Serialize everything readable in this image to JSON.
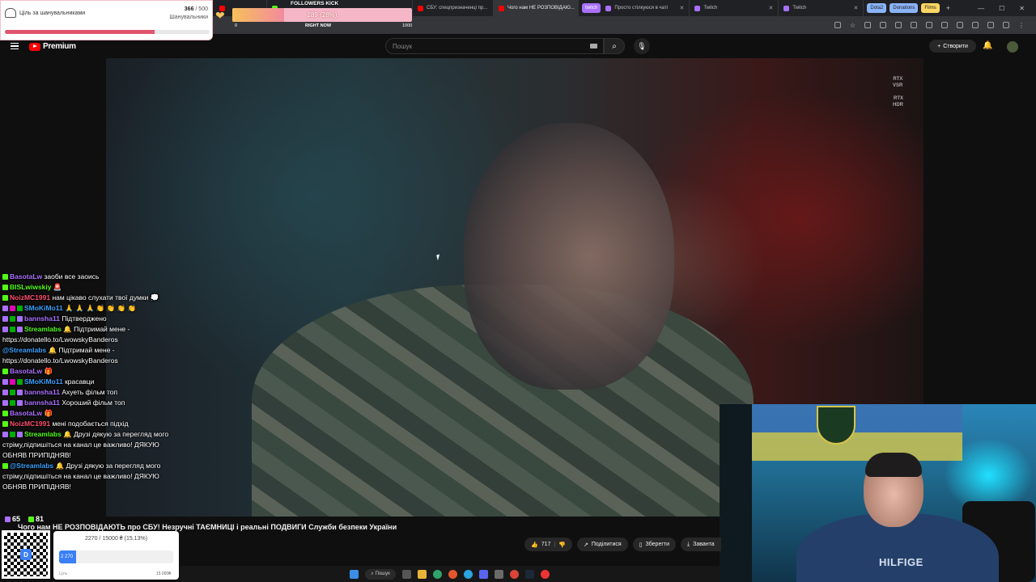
{
  "browser": {
    "tabs": [
      {
        "label": "",
        "color": "#ff0000",
        "active": false
      },
      {
        "label": "",
        "color": "#53fc18",
        "active": false
      },
      {
        "label": "СБУ: спецпризначенці пр...",
        "color": "#ff0000",
        "active": false
      },
      {
        "label": "Чого нам НЕ РОЗПОВІДАЮ...",
        "color": "#ff0000",
        "active": true
      },
      {
        "label": "Просто стілкуюся в чаті",
        "color": "#a970ff",
        "active": false
      },
      {
        "label": "Twitch",
        "color": "#a970ff",
        "active": false
      },
      {
        "label": "Twitch",
        "color": "#a970ff",
        "active": false
      }
    ],
    "twitch_group_label": "twitch",
    "groups": [
      {
        "label": "Dota2",
        "color": "#8ab4f8"
      },
      {
        "label": "Donations",
        "color": "#8ab4f8"
      },
      {
        "label": "Films",
        "color": "#fdd663"
      }
    ]
  },
  "youtube": {
    "logo_text": "Premium",
    "search_placeholder": "Пошук",
    "create_label": "Створити",
    "rtx_vsr": "RTX\nVSR",
    "rtx_hdr": "RTX\nHDR",
    "video_title": "Чого нам НЕ РОЗПОВІДАЮТЬ про СБУ! Незручні ТАЄМНИЦІ і реальні ПОДВИГИ Служби безпеки України",
    "likes": "717",
    "share_label": "Поділитися",
    "save_label": "Зберегти",
    "download_label": "Заванта"
  },
  "goal_widget": {
    "title": "Ціль за шанувальниками",
    "current": "366",
    "total": "/ 500",
    "subtitle": "Шанувальники",
    "progress": 0.732
  },
  "followers_kick": {
    "title": "FOLLOWERS KICK",
    "value_text": "289 (28%)",
    "progress": 0.289,
    "min": "0",
    "now_label": "RIGHT NOW",
    "max": "1000"
  },
  "chat": [
    {
      "badges": [
        "kick"
      ],
      "name": "BasotaLw",
      "color": "#a970ff",
      "text": "заоби все заоись"
    },
    {
      "badges": [
        "kick"
      ],
      "name": "BISLwiwskiy",
      "color": "#53fc18",
      "text": "🚨"
    },
    {
      "badges": [
        "kick"
      ],
      "name": "NoizMC1991",
      "color": "#ff4d6d",
      "text": "нам цікаво слухати твої думки 💭"
    },
    {
      "badges": [
        "sub",
        "vip",
        "mod"
      ],
      "name": "SMoKiMo11",
      "color": "#3aa0ff",
      "text": "🙏 🙏 🙏 👏 👏 👏 👏"
    },
    {
      "badges": [
        "sub",
        "mod",
        "sub"
      ],
      "name": "bannsha11",
      "color": "#a970ff",
      "text": "Підтверджено"
    },
    {
      "badges": [
        "sub",
        "mod",
        "sub"
      ],
      "name": "Streamlabs",
      "color": "#53fc18",
      "text": "🔔 Підтримай мене - https://donatello.to/LwowskyBanderos"
    },
    {
      "badges": [],
      "name": "@Streamlabs",
      "color": "#3aa0ff",
      "text": "🔔 Підтримай мене - https://donatello.to/LwowskyBanderos"
    },
    {
      "badges": [
        "kick"
      ],
      "name": "BasotaLw",
      "color": "#a970ff",
      "text": "🎁"
    },
    {
      "badges": [
        "sub",
        "vip",
        "mod"
      ],
      "name": "SMoKiMo11",
      "color": "#3aa0ff",
      "text": "красавци"
    },
    {
      "badges": [
        "sub",
        "mod",
        "sub"
      ],
      "name": "bannsha11",
      "color": "#a970ff",
      "text": "Ахуеть фільм топ"
    },
    {
      "badges": [
        "sub",
        "mod",
        "sub"
      ],
      "name": "bannsha11",
      "color": "#a970ff",
      "text": "Хороший фільм топ"
    },
    {
      "badges": [
        "kick"
      ],
      "name": "BasotaLw",
      "color": "#a970ff",
      "text": "🎁"
    },
    {
      "badges": [
        "kick"
      ],
      "name": "NoizMC1991",
      "color": "#ff4d6d",
      "text": "мені подобається підхід"
    },
    {
      "badges": [
        "sub",
        "mod",
        "sub"
      ],
      "name": "Streamlabs",
      "color": "#53fc18",
      "text": "🔔 Друзі дякую за перегляд мого стріму,підпишіться на канал це важливо! ДЯКУЮ ОБНЯВ ПРИПІДНЯВ!"
    },
    {
      "badges": [
        "kick"
      ],
      "name": "@Streamlabs",
      "color": "#3aa0ff",
      "text": "🔔 Друзі дякую за перегляд мого стріму,підпишіться на канал це важливо! ДЯКУЮ ОБНЯВ ПРИПІДНЯВ!"
    }
  ],
  "chat_stats": {
    "viewers_a": "65",
    "viewers_b": "81"
  },
  "donation_widget": {
    "top_text": "2270 / 15000 ₴ (15.13%)",
    "fill_text": "2 270",
    "progress": 0.1513,
    "min_label": "Ціль",
    "max_label": "15 000₴"
  },
  "taskbar": {
    "search_label": "Пошук"
  },
  "webcam": {
    "shirt_text": "HILFIGE"
  }
}
